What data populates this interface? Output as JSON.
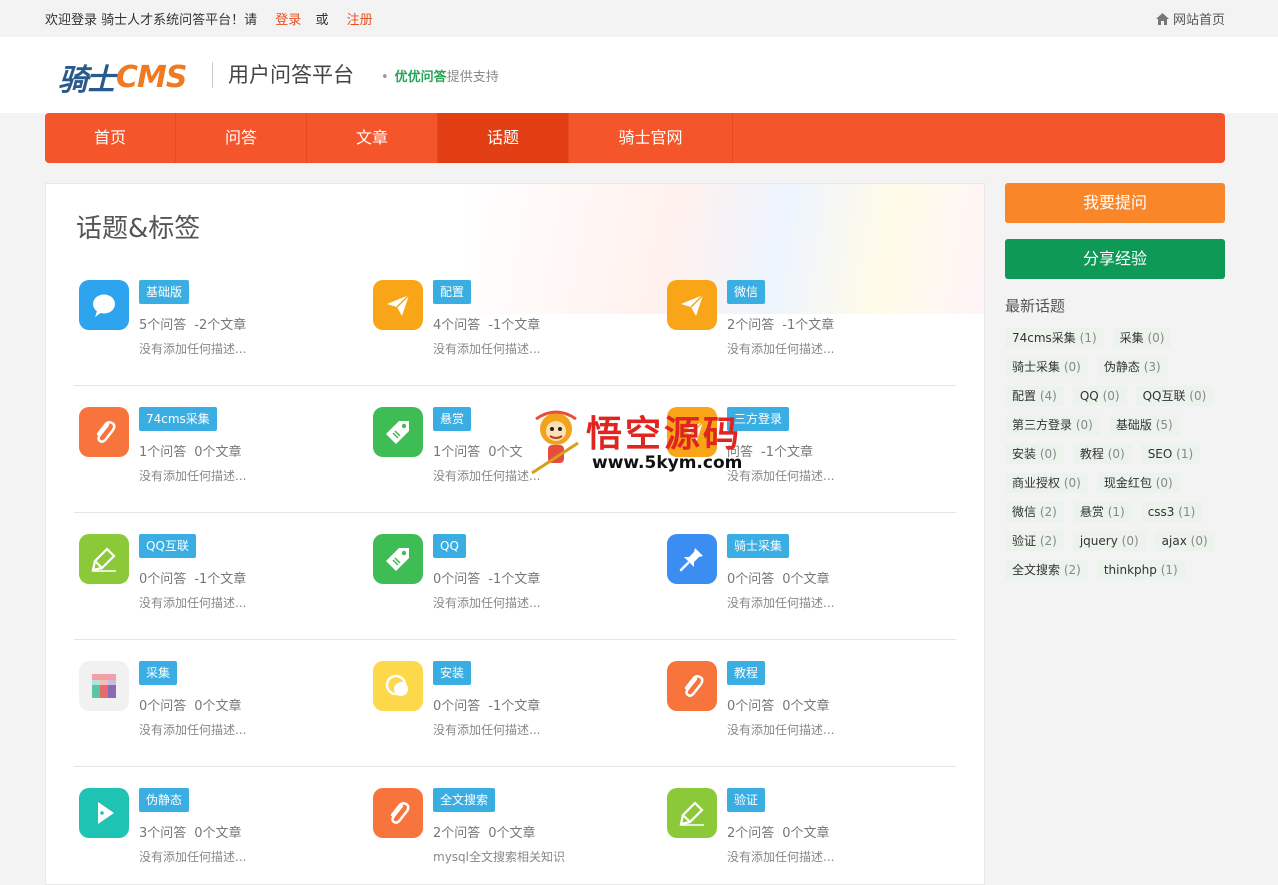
{
  "topbar": {
    "welcome": "欢迎登录 骑士人才系统问答平台！请",
    "login": "登录",
    "or": "或",
    "register": "注册",
    "home_link": "网站首页"
  },
  "header": {
    "logo_cn": "骑士",
    "logo_en": "CMS",
    "site_title": "用户问答平台",
    "support_dot": "•",
    "support_brand": "优优问答",
    "support_text": "提供支持"
  },
  "nav": {
    "items": [
      {
        "label": "首页"
      },
      {
        "label": "问答"
      },
      {
        "label": "文章"
      },
      {
        "label": "话题"
      },
      {
        "label": "骑士官网"
      }
    ],
    "active_index": 3
  },
  "main": {
    "title": "话题&标签",
    "topics": [
      {
        "tag": "基础版",
        "answers": "5个问答",
        "articles": "-2个文章",
        "desc": "没有添加任何描述...",
        "icon": "chat-bubble-icon",
        "color": "#2fa4ee"
      },
      {
        "tag": "配置",
        "answers": "4个问答",
        "articles": "-1个文章",
        "desc": "没有添加任何描述...",
        "icon": "paper-plane-icon",
        "color": "#f8a518"
      },
      {
        "tag": "微信",
        "answers": "2个问答",
        "articles": "-1个文章",
        "desc": "没有添加任何描述...",
        "icon": "paper-plane-icon",
        "color": "#f8a518"
      },
      {
        "tag": "74cms采集",
        "answers": "1个问答",
        "articles": "0个文章",
        "desc": "没有添加任何描述...",
        "icon": "paperclip-icon",
        "color": "#f7743d"
      },
      {
        "tag": "悬赏",
        "answers": "1个问答",
        "articles": "0个文",
        "desc": "没有添加任何描述...",
        "icon": "price-tag-icon",
        "color": "#3ebd55"
      },
      {
        "tag": "三方登录",
        "answers": "问答",
        "articles": "-1个文章",
        "desc": "没有添加任何描述...",
        "icon": "paper-plane-icon",
        "color": "#f8a518"
      },
      {
        "tag": "QQ互联",
        "answers": "0个问答",
        "articles": "-1个文章",
        "desc": "没有添加任何描述...",
        "icon": "highlighter-icon",
        "color": "#8cc938"
      },
      {
        "tag": "QQ",
        "answers": "0个问答",
        "articles": "-1个文章",
        "desc": "没有添加任何描述...",
        "icon": "price-tag-icon",
        "color": "#3ebd55"
      },
      {
        "tag": "骑士采集",
        "answers": "0个问答",
        "articles": "0个文章",
        "desc": "没有添加任何描述...",
        "icon": "pushpin-icon",
        "color": "#3c8df2"
      },
      {
        "tag": "采集",
        "answers": "0个问答",
        "articles": "0个文章",
        "desc": "没有添加任何描述...",
        "icon": "color-grid-icon",
        "color": "#f1f1f1"
      },
      {
        "tag": "安装",
        "answers": "0个问答",
        "articles": "-1个文章",
        "desc": "没有添加任何描述...",
        "icon": "circles-icon",
        "color": "#fdd84a"
      },
      {
        "tag": "教程",
        "answers": "0个问答",
        "articles": "0个文章",
        "desc": "没有添加任何描述...",
        "icon": "paperclip-icon",
        "color": "#f7743d"
      },
      {
        "tag": "伪静态",
        "answers": "3个问答",
        "articles": "0个文章",
        "desc": "没有添加任何描述...",
        "icon": "play-icon",
        "color": "#1fc3b3"
      },
      {
        "tag": "全文搜索",
        "answers": "2个问答",
        "articles": "0个文章",
        "desc": "mysql全文搜索相关知识",
        "icon": "paperclip-icon",
        "color": "#f7743d"
      },
      {
        "tag": "验证",
        "answers": "2个问答",
        "articles": "0个文章",
        "desc": "没有添加任何描述...",
        "icon": "highlighter-icon",
        "color": "#8cc938"
      }
    ]
  },
  "sidebar": {
    "ask_button": "我要提问",
    "share_button": "分享经验",
    "latest_title": "最新话题",
    "tags": [
      {
        "name": "74cms采集",
        "count": "(1)"
      },
      {
        "name": "采集",
        "count": "(0)"
      },
      {
        "name": "骑士采集",
        "count": "(0)"
      },
      {
        "name": "伪静态",
        "count": "(3)"
      },
      {
        "name": "配置",
        "count": "(4)"
      },
      {
        "name": "QQ",
        "count": "(0)"
      },
      {
        "name": "QQ互联",
        "count": "(0)"
      },
      {
        "name": "第三方登录",
        "count": "(0)"
      },
      {
        "name": "基础版",
        "count": "(5)"
      },
      {
        "name": "安装",
        "count": "(0)"
      },
      {
        "name": "教程",
        "count": "(0)"
      },
      {
        "name": "SEO",
        "count": "(1)"
      },
      {
        "name": "商业授权",
        "count": "(0)"
      },
      {
        "name": "现金红包",
        "count": "(0)"
      },
      {
        "name": "微信",
        "count": "(2)"
      },
      {
        "name": "悬赏",
        "count": "(1)"
      },
      {
        "name": "css3",
        "count": "(1)"
      },
      {
        "name": "验证",
        "count": "(2)"
      },
      {
        "name": "jquery",
        "count": "(0)"
      },
      {
        "name": "ajax",
        "count": "(0)"
      },
      {
        "name": "全文搜索",
        "count": "(2)"
      },
      {
        "name": "thinkphp",
        "count": "(1)"
      }
    ]
  },
  "watermark": {
    "text": "悟空源码",
    "url": "www.5kym.com"
  }
}
